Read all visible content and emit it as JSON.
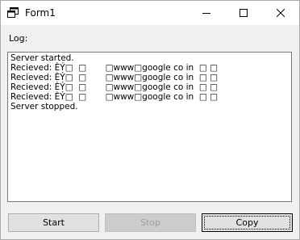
{
  "window": {
    "title": "Form1"
  },
  "log": {
    "label": "Log:",
    "lines": [
      "Server started.",
      "Recieved: ÈÝ□  □       □www□google co in  □ □",
      "Recieved: ÈÝ□  □       □www□google co in  □ □",
      "Recieved: ÈÝ□  □       □www□google co in  □ □",
      "Recieved: ÈÝ□  □       □www□google co in  □ □",
      "Server stopped."
    ]
  },
  "buttons": {
    "start": "Start",
    "stop": "Stop",
    "copy": "Copy"
  },
  "icons": {
    "app": "app-window-icon",
    "minimize": "minimize-icon",
    "maximize": "maximize-icon",
    "close": "close-icon"
  }
}
